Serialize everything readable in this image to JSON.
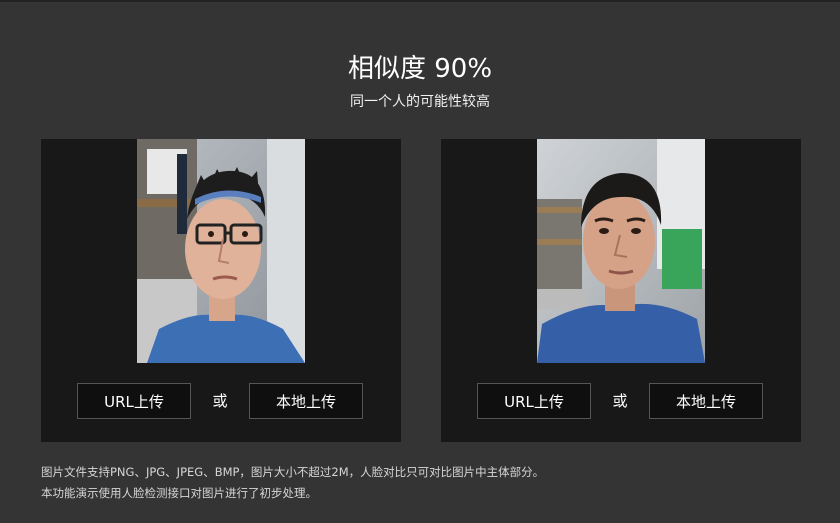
{
  "result": {
    "title": "相似度 90%",
    "subtitle": "同一个人的可能性较高"
  },
  "panels": [
    {
      "photo_alt": "face photo 1",
      "url_button": "URL上传",
      "or_label": "或",
      "local_button": "本地上传"
    },
    {
      "photo_alt": "face photo 2",
      "url_button": "URL上传",
      "or_label": "或",
      "local_button": "本地上传"
    }
  ],
  "notes": [
    "图片文件支持PNG、JPG、JPEG、BMP，图片大小不超过2M，人脸对比只可对比图片中主体部分。",
    "本功能演示使用人脸检测接口对图片进行了初步处理。"
  ],
  "colors": {
    "background": "#343434",
    "panel": "#181818",
    "button_bg": "#0f0f0f",
    "button_border": "#555555"
  }
}
